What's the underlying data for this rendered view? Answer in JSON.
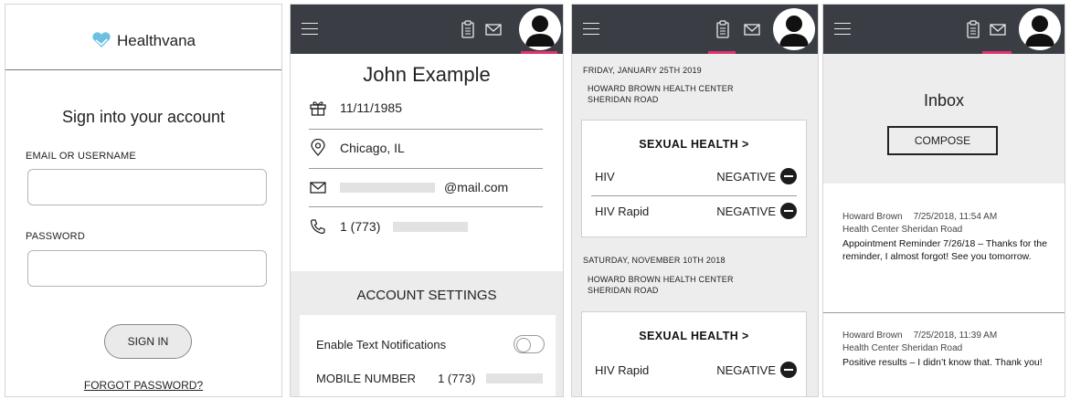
{
  "colors": {
    "topbar": "#3a3e44",
    "accent": "#e0336e",
    "logo": "#6cc0e0"
  },
  "login": {
    "brand": "Healthvana",
    "title": "Sign into your account",
    "email_label": "EMAIL OR USERNAME",
    "email_value": "",
    "password_label": "PASSWORD",
    "password_value": "",
    "signin_label": "SIGN IN",
    "forgot_label": "FORGOT PASSWORD?"
  },
  "nav": {
    "icons": [
      "hamburger-icon",
      "clipboard-icon",
      "envelope-icon",
      "avatar"
    ]
  },
  "profile": {
    "name": "John Example",
    "dob": "11/11/1985",
    "location": "Chicago, IL",
    "email_suffix": "@mail.com",
    "phone_prefix": "1 (773)",
    "settings_title": "ACCOUNT SETTINGS",
    "text_notifications_label": "Enable Text Notifications",
    "text_notifications_enabled": false,
    "mobile_label": "MOBILE NUMBER",
    "mobile_prefix": "1 (773)"
  },
  "results": {
    "visits": [
      {
        "date": "FRIDAY, JANUARY 25TH 2019",
        "location_line1": "HOWARD BROWN HEALTH CENTER",
        "location_line2": "SHERIDAN ROAD",
        "section": "SEXUAL HEALTH >",
        "tests": [
          {
            "name": "HIV",
            "result": "NEGATIVE"
          },
          {
            "name": "HIV Rapid",
            "result": "NEGATIVE"
          }
        ]
      },
      {
        "date": "SATURDAY, NOVEMBER 10TH 2018",
        "location_line1": "HOWARD BROWN HEALTH CENTER",
        "location_line2": "SHERIDAN ROAD",
        "section": "SEXUAL HEALTH >",
        "tests": [
          {
            "name": "HIV Rapid",
            "result": "NEGATIVE"
          }
        ]
      }
    ]
  },
  "inbox": {
    "title": "Inbox",
    "compose_label": "COMPOSE",
    "messages": [
      {
        "sender_line1": "Howard Brown",
        "sender_line2": "Health Center Sheridan Road",
        "timestamp": "7/25/2018, 11:54 AM",
        "body": "Appointment Reminder 7/26/18 – Thanks for the reminder, I almost forgot! See you tomorrow."
      },
      {
        "sender_line1": "Howard Brown",
        "sender_line2": "Health Center Sheridan Road",
        "timestamp": "7/25/2018, 11:39 AM",
        "body": "Positive results – I didn’t know that. Thank you!"
      }
    ]
  }
}
